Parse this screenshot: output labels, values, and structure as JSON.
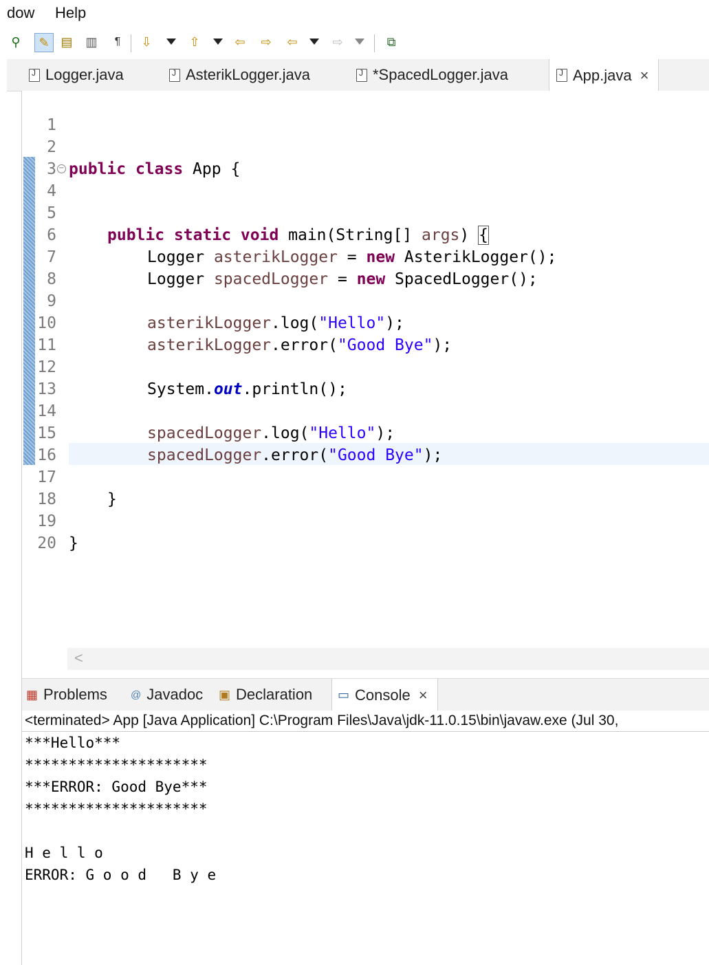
{
  "menu": {
    "items": [
      "dow",
      "Help"
    ]
  },
  "toolbar": {
    "icons": [
      "pin-icon",
      "highlight-icon",
      "toggle-block-icon",
      "show-whitespace-icon",
      "pilcrow-icon",
      "next-annotation-icon",
      "prev-annotation-icon",
      "last-edit-icon",
      "forward-edit-icon",
      "back-icon",
      "forward-icon",
      "new-window-icon"
    ]
  },
  "editor_tabs": [
    {
      "label": "Logger.java"
    },
    {
      "label": "AsterikLogger.java"
    },
    {
      "label": "*SpacedLogger.java"
    },
    {
      "label": "App.java",
      "active": true
    }
  ],
  "editor": {
    "line_numbers": [
      "1",
      "2",
      "3",
      "4",
      "5",
      "6",
      "7",
      "8",
      "9",
      "10",
      "11",
      "12",
      "13",
      "14",
      "15",
      "16",
      "17",
      "18",
      "19",
      "20"
    ],
    "code": {
      "l2": {
        "k1": "public",
        "k2": "class",
        "rest": " App {"
      },
      "l4": {
        "k1": "public",
        "k2": "static",
        "k3": "void",
        "m": " main(String[] ",
        "v": "args",
        "p": ") ",
        "b": "{"
      },
      "l6": {
        "t": "Logger ",
        "v": "asterikLogger",
        "eq": " = ",
        "k": "new",
        "rest": " AsterikLogger();"
      },
      "l7": {
        "t": "Logger ",
        "v": "spacedLogger",
        "eq": " = ",
        "k": "new",
        "rest": " SpacedLogger();"
      },
      "l9": {
        "v": "asterikLogger",
        "m": ".log(",
        "s": "\"Hello\"",
        "e": ");"
      },
      "l10": {
        "v": "asterikLogger",
        "m": ".error(",
        "s": "\"Good Bye\"",
        "e": ");"
      },
      "l12": {
        "a": "System.",
        "f": "out",
        "b": ".println();"
      },
      "l14": {
        "v": "spacedLogger",
        "m": ".log(",
        "s": "\"Hello\"",
        "e": ");"
      },
      "l15": {
        "v": "spacedLogger",
        "m": ".error(",
        "s": "\"Good Bye\"",
        "e": ");"
      },
      "l17": "}",
      "l19": "}"
    },
    "scroll_arrow": "<"
  },
  "view_tabs": [
    {
      "label": "Problems"
    },
    {
      "label": "Javadoc"
    },
    {
      "label": "Declaration"
    },
    {
      "label": "Console",
      "active": true
    }
  ],
  "console": {
    "header": "<terminated> App [Java Application] C:\\Program Files\\Java\\jdk-11.0.15\\bin\\javaw.exe  (Jul 30,",
    "lines": [
      "***Hello***",
      "*********************",
      "***ERROR: Good Bye***",
      "*********************",
      "",
      "H e l l o",
      "ERROR: G o o d   B y e"
    ]
  },
  "colors": {
    "keyword": "#7f0055",
    "variable": "#6a3e3e",
    "string": "#2a00ff",
    "field": "#0000c0"
  }
}
